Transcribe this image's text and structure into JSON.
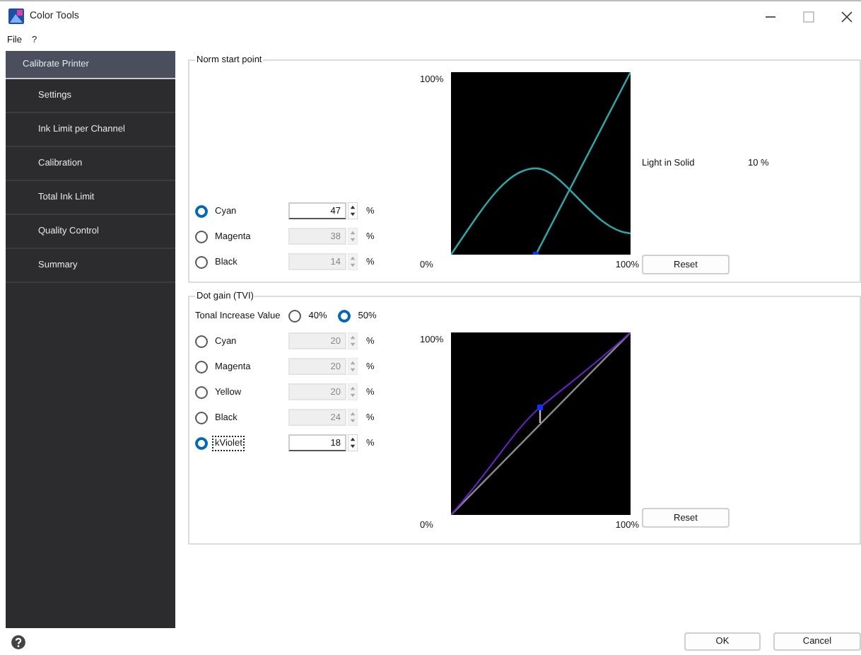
{
  "window": {
    "title": "Color Tools"
  },
  "menu": [
    "File",
    "?"
  ],
  "sidebar": {
    "items": [
      {
        "label": "Calibrate Printer",
        "selected": true
      },
      {
        "label": "Settings",
        "selected": false
      },
      {
        "label": "Ink Limit per Channel",
        "selected": false
      },
      {
        "label": "Calibration",
        "selected": false
      },
      {
        "label": "Total Ink Limit",
        "selected": false
      },
      {
        "label": "Quality Control",
        "selected": false
      },
      {
        "label": "Summary",
        "selected": false
      }
    ]
  },
  "norm_start_point": {
    "title": "Norm start point",
    "channels": [
      {
        "name": "Cyan",
        "selected": true,
        "value": "47",
        "unit": "%",
        "disabled": false
      },
      {
        "name": "Magenta",
        "selected": false,
        "value": "38",
        "unit": "%",
        "disabled": true
      },
      {
        "name": "Black",
        "selected": false,
        "value": "14",
        "unit": "%",
        "disabled": true
      }
    ],
    "chart": {
      "y_max": "100%",
      "x_min": "0%",
      "x_max": "100%"
    },
    "light_in_solid": {
      "label": "Light in Solid",
      "value": "10 %"
    },
    "reset": "Reset"
  },
  "dot_gain": {
    "title": "Dot gain (TVI)",
    "tonal_increase": {
      "label": "Tonal Increase Value",
      "options": [
        {
          "label": "40%",
          "selected": false
        },
        {
          "label": "50%",
          "selected": true
        }
      ]
    },
    "channels": [
      {
        "name": "Cyan",
        "selected": false,
        "value": "20",
        "unit": "%",
        "disabled": true,
        "focused": false
      },
      {
        "name": "Magenta",
        "selected": false,
        "value": "20",
        "unit": "%",
        "disabled": true,
        "focused": false
      },
      {
        "name": "Yellow",
        "selected": false,
        "value": "20",
        "unit": "%",
        "disabled": true,
        "focused": false
      },
      {
        "name": "Black",
        "selected": false,
        "value": "24",
        "unit": "%",
        "disabled": true,
        "focused": false
      },
      {
        "name": "kViolet",
        "selected": true,
        "value": "18",
        "unit": "%",
        "disabled": false,
        "focused": true
      }
    ],
    "chart": {
      "y_max": "100%",
      "x_min": "0%",
      "x_max": "100%"
    },
    "reset": "Reset"
  },
  "footer": {
    "buttons": [
      "OK",
      "Cancel"
    ]
  }
}
